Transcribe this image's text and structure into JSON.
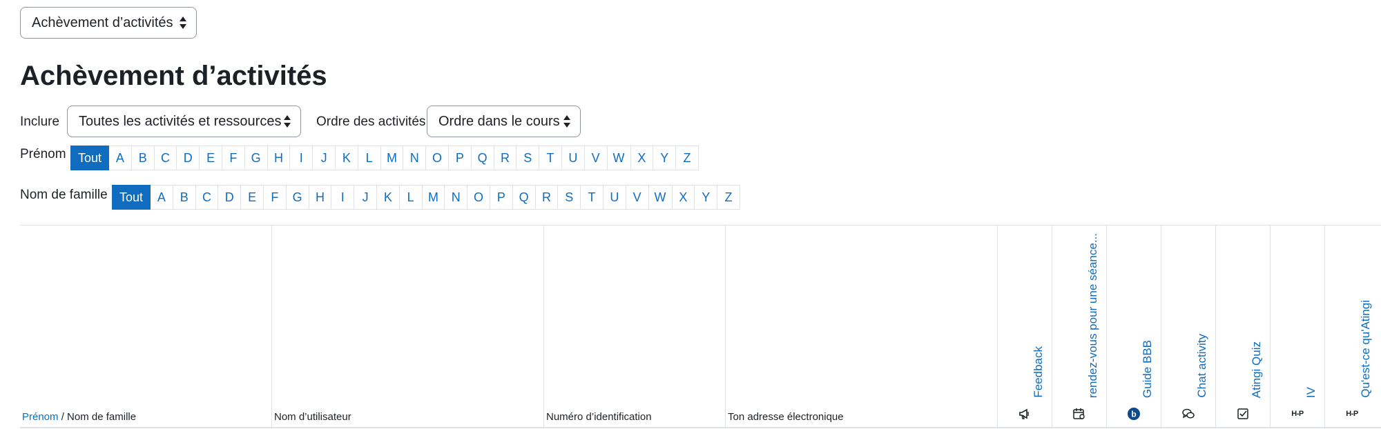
{
  "top_select": {
    "value": "Achèvement d’activités"
  },
  "page_title": "Achèvement d’activités",
  "include": {
    "label": "Inclure",
    "value": "Toutes les activités et ressources"
  },
  "order": {
    "label": "Ordre des activités",
    "value": "Ordre dans le cours"
  },
  "firstname_filter": {
    "label": "Prénom",
    "all": "Tout",
    "letters": [
      "A",
      "B",
      "C",
      "D",
      "E",
      "F",
      "G",
      "H",
      "I",
      "J",
      "K",
      "L",
      "M",
      "N",
      "O",
      "P",
      "Q",
      "R",
      "S",
      "T",
      "U",
      "V",
      "W",
      "X",
      "Y",
      "Z"
    ]
  },
  "lastname_filter": {
    "label": "Nom de famille",
    "all": "Tout",
    "letters": [
      "A",
      "B",
      "C",
      "D",
      "E",
      "F",
      "G",
      "H",
      "I",
      "J",
      "K",
      "L",
      "M",
      "N",
      "O",
      "P",
      "Q",
      "R",
      "S",
      "T",
      "U",
      "V",
      "W",
      "X",
      "Y",
      "Z"
    ]
  },
  "table": {
    "headers": {
      "firstname": "Prénom",
      "separator": " / ",
      "lastname": "Nom de famille",
      "username": "Nom d’utilisateur",
      "idnumber": "Numéro d’identification",
      "email": "Ton adresse électronique"
    },
    "activities": [
      {
        "label": "Feedback",
        "icon": "feedback-icon"
      },
      {
        "label": "rendez-vous pour une séance...",
        "icon": "scheduler-icon"
      },
      {
        "label": "Guide BBB",
        "icon": "bigbluebutton-icon"
      },
      {
        "label": "Chat activity",
        "icon": "chat-icon"
      },
      {
        "label": "Atingi Quiz",
        "icon": "quiz-icon"
      },
      {
        "label": "IV",
        "icon": "h5p-icon",
        "icon_text": "H-P"
      },
      {
        "label": "Qu'est-ce qu'Atingi",
        "icon": "h5p-icon",
        "icon_text": "H-P"
      }
    ]
  },
  "colors": {
    "accent": "#0f6cbf",
    "border": "#dee2e6",
    "text": "#1d2125"
  }
}
